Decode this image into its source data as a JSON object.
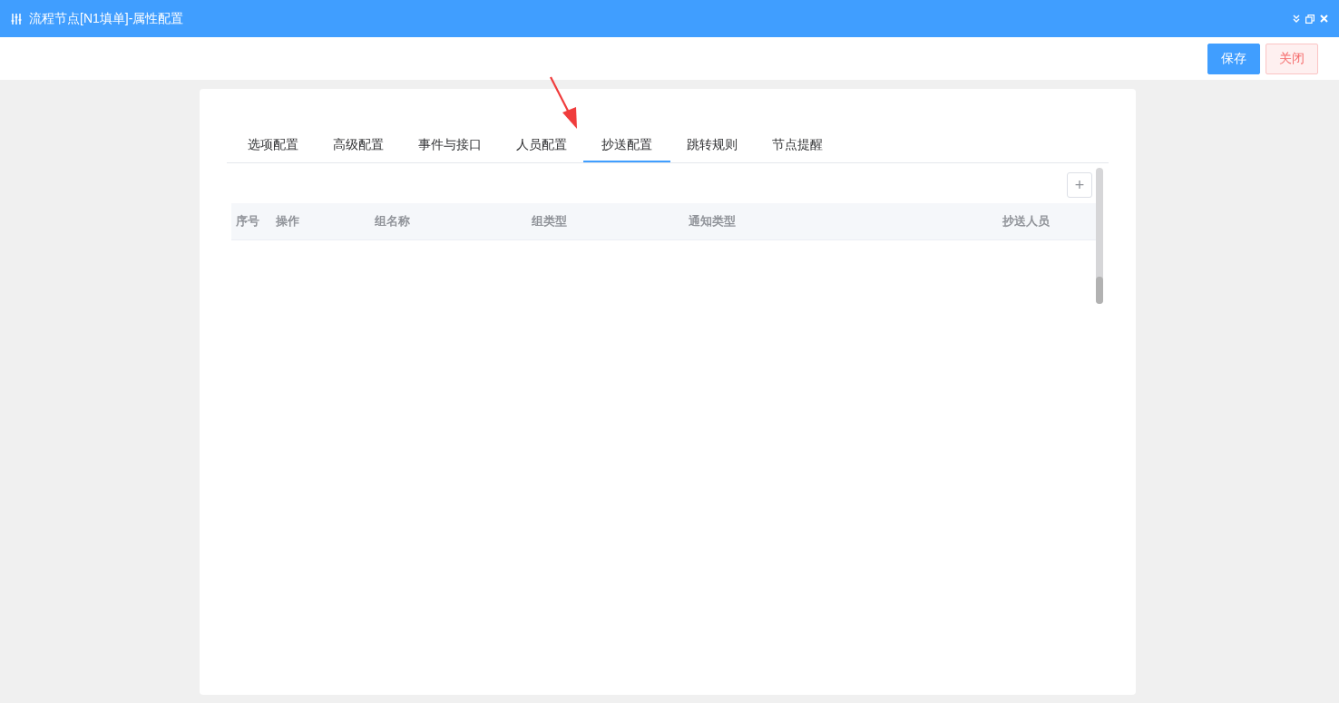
{
  "window": {
    "title": "流程节点[N1填单]-属性配置"
  },
  "toolbar": {
    "buttons": [
      {
        "label": "保存",
        "kind": "primary"
      },
      {
        "label": "关闭",
        "kind": "danger"
      }
    ]
  },
  "tabs": [
    {
      "label": "选项配置",
      "selected": false
    },
    {
      "label": "高级配置",
      "selected": false
    },
    {
      "label": "事件与接口",
      "selected": false
    },
    {
      "label": "人员配置",
      "selected": false
    },
    {
      "label": "抄送配置",
      "selected": true
    },
    {
      "label": "跳转规则",
      "selected": false
    },
    {
      "label": "节点提醒",
      "selected": false
    }
  ],
  "add_button": {
    "label": "+"
  },
  "table": {
    "columns": [
      "序号",
      "操作",
      "组名称",
      "组类型",
      "通知类型",
      "抄送人员"
    ]
  }
}
